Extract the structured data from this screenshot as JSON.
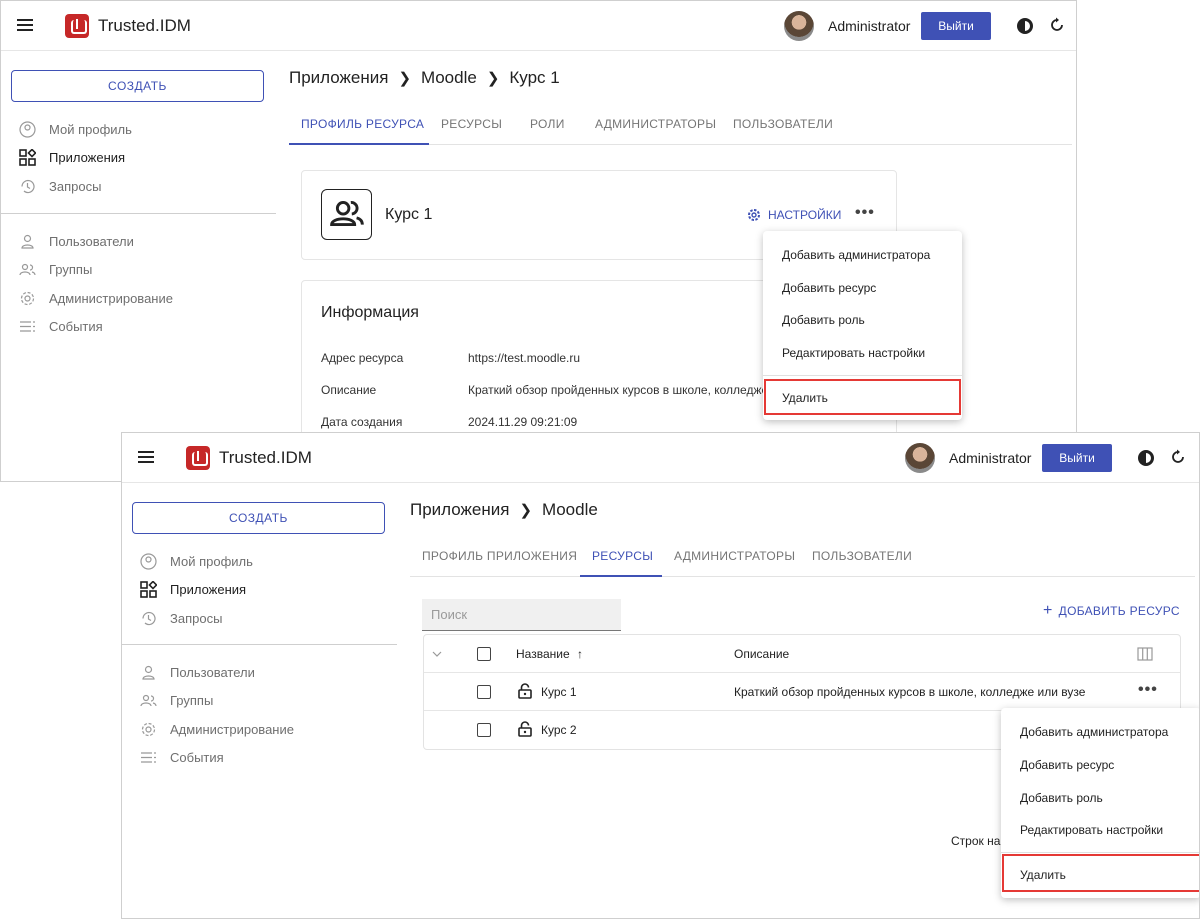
{
  "header": {
    "app_title": "Trusted.IDM",
    "user_name": "Administrator",
    "logout_label": "Выйти"
  },
  "sidebar": {
    "create_label": "СОЗДАТЬ",
    "items": [
      {
        "label": "Мой профиль",
        "icon": "account-circle-icon"
      },
      {
        "label": "Приложения",
        "icon": "apps-grid-icon"
      },
      {
        "label": "Запросы",
        "icon": "history-icon"
      },
      {
        "label": "Пользователи",
        "icon": "person-icon"
      },
      {
        "label": "Группы",
        "icon": "group-icon"
      },
      {
        "label": "Администрирование",
        "icon": "gear-icon"
      },
      {
        "label": "События",
        "icon": "list-icon"
      }
    ]
  },
  "screen1": {
    "breadcrumb": [
      "Приложения",
      "Moodle",
      "Курс 1"
    ],
    "tabs": [
      "ПРОФИЛЬ РЕСУРСА",
      "РЕСУРСЫ",
      "РОЛИ",
      "АДМИНИСТРАТОРЫ",
      "ПОЛЬЗОВАТЕЛИ"
    ],
    "resource_title": "Курс 1",
    "settings_label": "НАСТРОЙКИ",
    "info_title": "Информация",
    "info_rows": [
      {
        "label": "Адрес ресурса",
        "value": "https://test.moodle.ru"
      },
      {
        "label": "Описание",
        "value": "Краткий обзор пройденных курсов в школе, колледже"
      },
      {
        "label": "Дата создания",
        "value": "2024.11.29 09:21:09"
      }
    ],
    "menu": [
      "Добавить администратора",
      "Добавить ресурс",
      "Добавить роль",
      "Редактировать настройки",
      "Удалить"
    ]
  },
  "screen2": {
    "breadcrumb": [
      "Приложения",
      "Moodle"
    ],
    "tabs": [
      "ПРОФИЛЬ ПРИЛОЖЕНИЯ",
      "РЕСУРСЫ",
      "АДМИНИСТРАТОРЫ",
      "ПОЛЬЗОВАТЕЛИ"
    ],
    "search_placeholder": "Поиск",
    "add_resource_label": "ДОБАВИТЬ РЕСУРС",
    "table": {
      "columns": [
        "Название",
        "Описание"
      ],
      "rows": [
        {
          "name": "Курс 1",
          "description": "Краткий обзор пройденных курсов в школе, колледже или вузе"
        },
        {
          "name": "Курс 2",
          "description": ""
        }
      ]
    },
    "pager_label": "Строк на",
    "menu": [
      "Добавить администратора",
      "Добавить ресурс",
      "Добавить роль",
      "Редактировать настройки",
      "Удалить"
    ]
  },
  "colors": {
    "accent": "#3f51b5",
    "brand": "#c62828",
    "highlight": "#e53935"
  }
}
